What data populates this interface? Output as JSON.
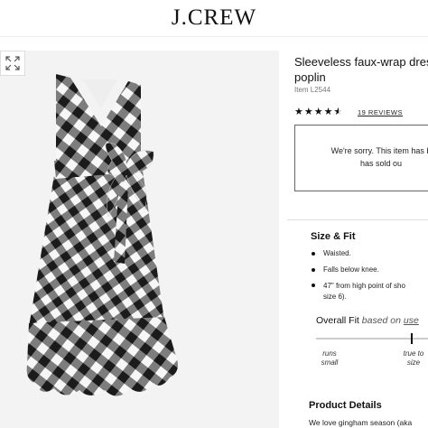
{
  "header": {
    "brand": "J.CREW"
  },
  "product": {
    "title_line1": "Sleeveless faux-wrap dress",
    "title_line2": "poplin",
    "item_number": "Item L2544",
    "rating": 4.5,
    "reviews_label": "19 REVIEWS",
    "soldout_line1": "We're sorry. This item has b",
    "soldout_line2": "has sold ou"
  },
  "size_fit": {
    "title": "Size & Fit",
    "bullets": [
      "Waisted.",
      "Falls below knee."
    ],
    "length_line1": "47\" from high point of sho",
    "length_line2": "size 6)."
  },
  "overall_fit": {
    "label": "Overall Fit",
    "based_on_prefix": "based on",
    "based_on_link": "use",
    "left_label_line1": "runs",
    "left_label_line2": "small",
    "right_label_line1": "true to",
    "right_label_line2": "size"
  },
  "product_details": {
    "title": "Product Details",
    "text": "We love gingham season (aka"
  },
  "icons": {
    "wishlist": "heart-icon",
    "zoom": "expand-icon",
    "rating": "star-icon"
  },
  "colors": {
    "gingham_dark": "#1b1b1b",
    "gingham_mid": "#7d7d7d",
    "gingham_light": "#f7f7f7",
    "gallery_bg": "#f3f3f3"
  }
}
